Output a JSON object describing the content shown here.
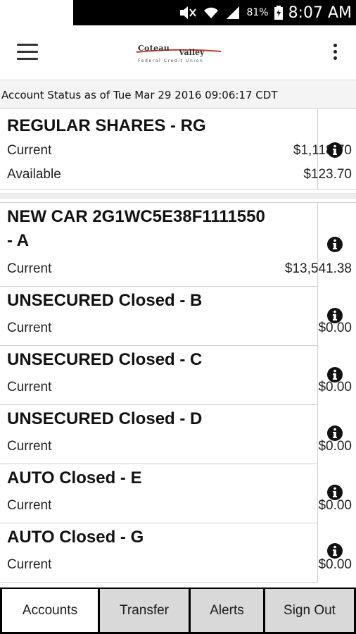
{
  "status_bar": {
    "battery_percent": "81%",
    "time": "8:07 AM"
  },
  "app_bar": {
    "logo": {
      "line1": "Coteau",
      "line2": "Valley",
      "subtitle": "Federal Credit Union"
    }
  },
  "account_status": "Account Status as of Tue Mar 29 2016 09:06:17 CDT",
  "accounts": [
    {
      "title_lines": [
        "REGULAR SHARES - RG"
      ],
      "rows": [
        {
          "label": "Current",
          "amount": "$1,118.70"
        },
        {
          "label": "Available",
          "amount": "$123.70"
        }
      ]
    },
    {
      "title_lines": [
        "NEW  CAR 2G1WC5E38F1111550",
        "- A"
      ],
      "rows": [
        {
          "label": "Current",
          "amount": "$13,541.38"
        }
      ]
    },
    {
      "title_lines": [
        "UNSECURED Closed - B"
      ],
      "rows": [
        {
          "label": "Current",
          "amount": "$0.00"
        }
      ]
    },
    {
      "title_lines": [
        "UNSECURED Closed - C"
      ],
      "rows": [
        {
          "label": "Current",
          "amount": "$0.00"
        }
      ]
    },
    {
      "title_lines": [
        "UNSECURED Closed - D"
      ],
      "rows": [
        {
          "label": "Current",
          "amount": "$0.00"
        }
      ]
    },
    {
      "title_lines": [
        "AUTO Closed - E"
      ],
      "rows": [
        {
          "label": "Current",
          "amount": "$0.00"
        }
      ]
    },
    {
      "title_lines": [
        "AUTO Closed - G"
      ],
      "rows": [
        {
          "label": "Current",
          "amount": "$0.00"
        }
      ]
    }
  ],
  "tabs": [
    {
      "label": "Accounts",
      "active": true
    },
    {
      "label": "Transfer",
      "active": false
    },
    {
      "label": "Alerts",
      "active": false
    },
    {
      "label": "Sign Out",
      "active": false
    }
  ],
  "icons": {
    "menu": "hamburger-menu-icon",
    "overflow": "more-vert-icon",
    "info": "info-circle-icon"
  }
}
